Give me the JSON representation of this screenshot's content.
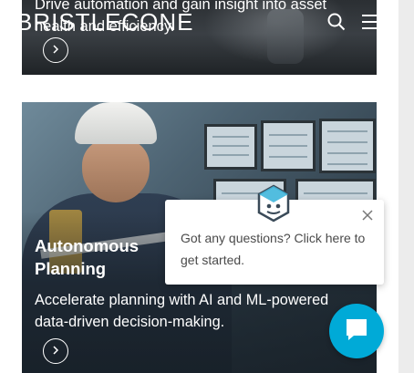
{
  "header": {
    "logo_text": "BRISTLECONE",
    "search_icon": "search-icon",
    "menu_icon": "hamburger-menu-icon"
  },
  "cards": [
    {
      "description": "Drive automation and gain insight into asset health and efficiency.",
      "button_icon": "chevron-right-icon"
    },
    {
      "title_line1": "Autonomous",
      "title_line2": "Planning",
      "description": "Accelerate planning with AI and ML-powered data-driven decision-making.",
      "button_icon": "chevron-right-icon"
    }
  ],
  "chat": {
    "popup_text": "Got any questions? Click here to get started.",
    "close_icon": "close-icon",
    "avatar_icon": "chatbot-avatar-icon",
    "launcher_icon": "chat-bubble-icon",
    "accent_color": "#00aad7"
  }
}
